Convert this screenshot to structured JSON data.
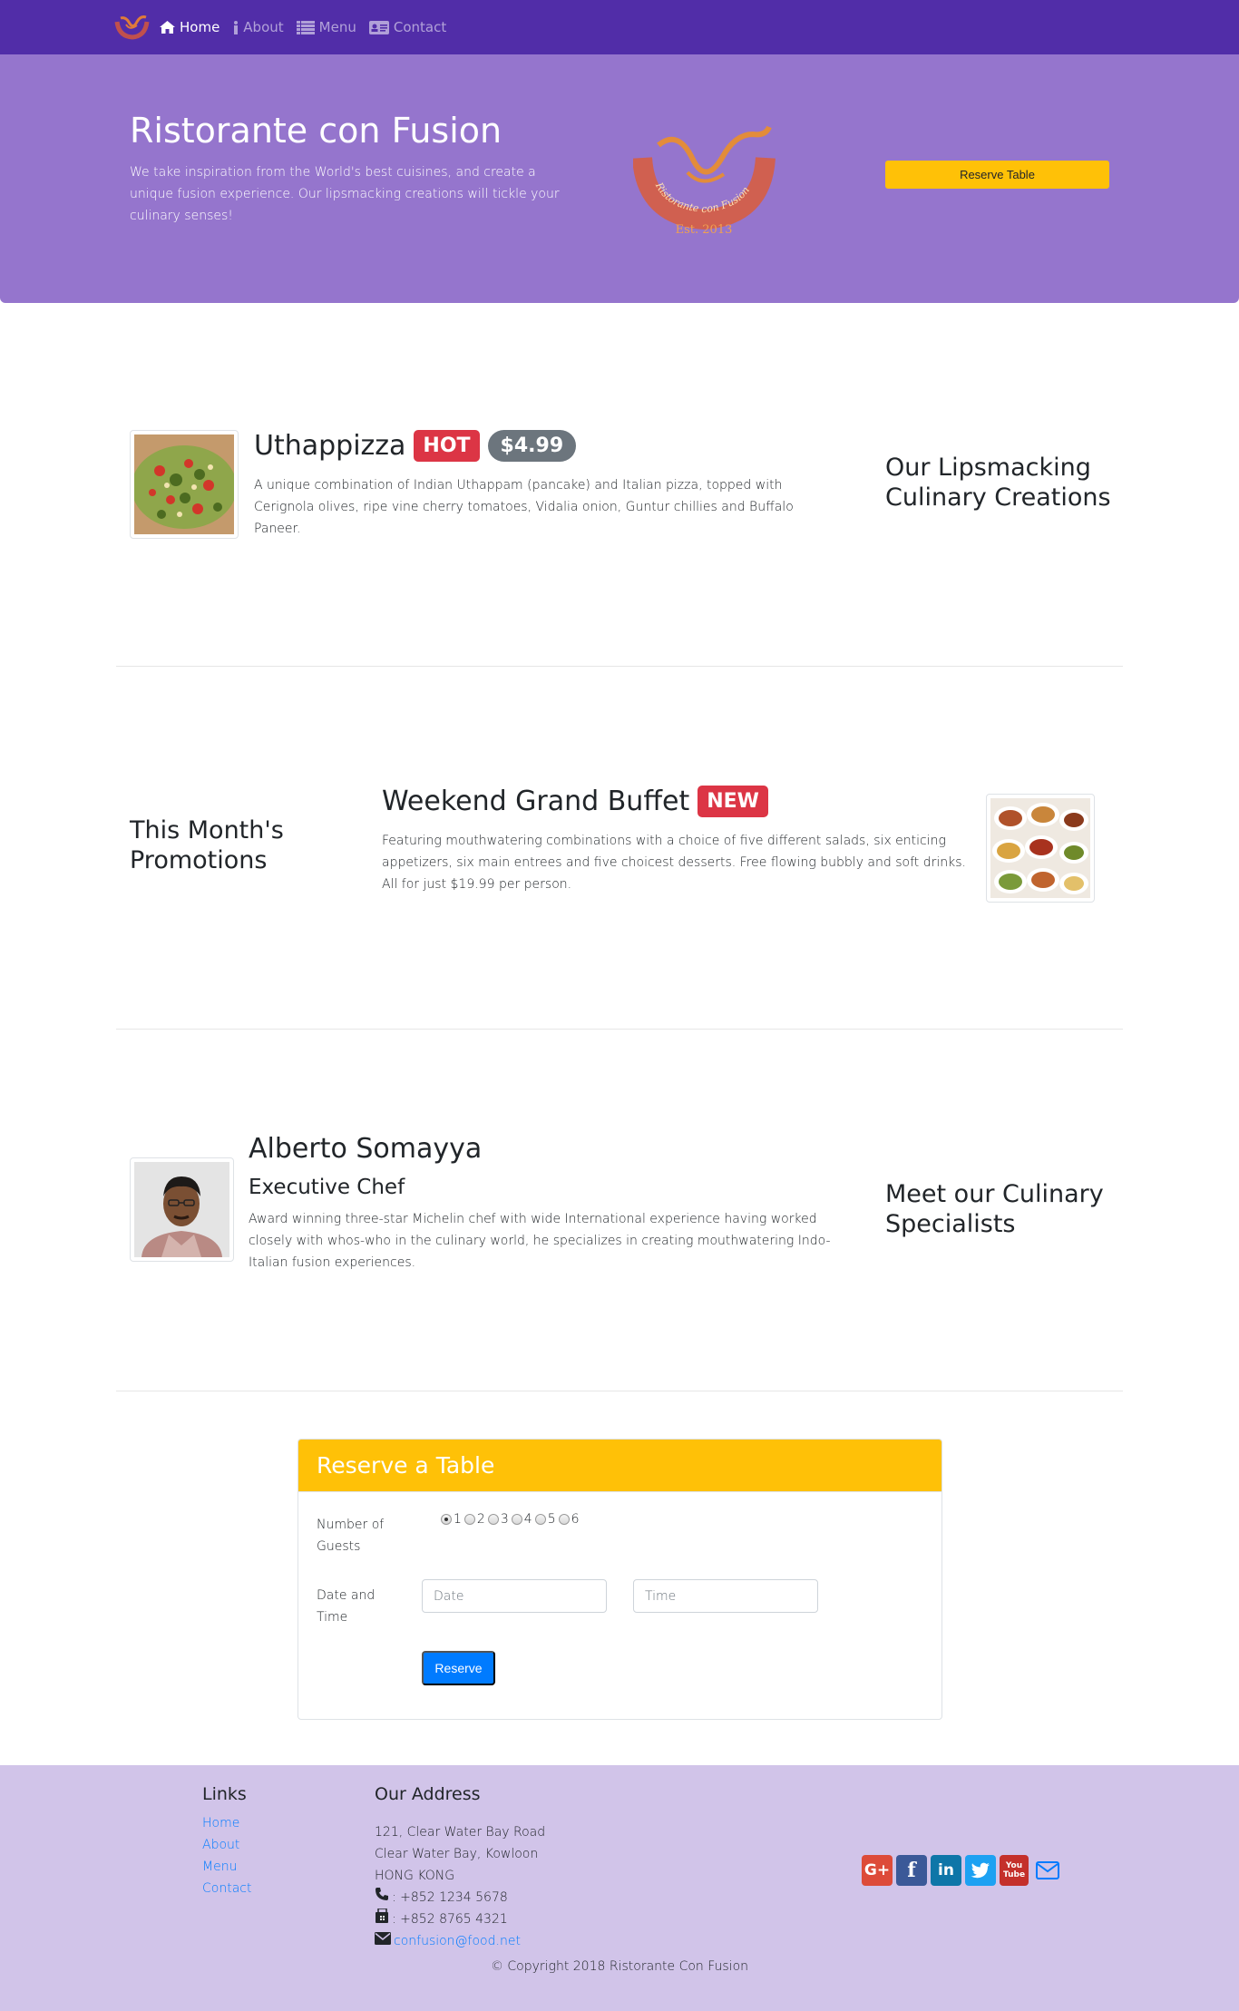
{
  "colors": {
    "navbar": "#512da8",
    "jumbotron": "#9575cd",
    "footer": "#d1c4e9",
    "warning": "#ffc107",
    "danger": "#dc3545",
    "secondary": "#6c757d",
    "primary": "#007bff"
  },
  "navbar": {
    "logo_icon": "restaurant-logo-icon",
    "items": [
      {
        "label": "Home",
        "icon": "home-icon",
        "active": true
      },
      {
        "label": "About",
        "icon": "info-icon",
        "active": false
      },
      {
        "label": "Menu",
        "icon": "list-icon",
        "active": false
      },
      {
        "label": "Contact",
        "icon": "address-card-icon",
        "active": false
      }
    ]
  },
  "jumbotron": {
    "title": "Ristorante con Fusion",
    "text": "We take inspiration from the World's best cuisines, and create a unique fusion experience. Our lipsmacking creations will tickle your culinary senses!",
    "logo_text": "Ristorante con Fusion",
    "logo_est": "Est. 2013",
    "reserve_button": "Reserve Table"
  },
  "dish": {
    "name": "Uthappizza",
    "badge": "HOT",
    "price": "$4.99",
    "description": "A unique combination of Indian Uthappam (pancake) and Italian pizza, topped with Cerignola olives, ripe vine cherry tomatoes, Vidalia onion, Guntur chillies and Buffalo Paneer.",
    "section_heading": "Our Lipsmacking Culinary Creations"
  },
  "promotion": {
    "section_heading": "This Month's Promotions",
    "name": "Weekend Grand Buffet",
    "badge": "NEW",
    "description": "Featuring mouthwatering combinations with a choice of five different salads, six enticing appetizers, six main entrees and five choicest desserts. Free flowing bubbly and soft drinks. All for just $19.99 per person."
  },
  "leader": {
    "name": "Alberto Somayya",
    "designation": "Executive Chef",
    "description": "Award winning three-star Michelin chef with wide International experience having worked closely with whos-who in the culinary world, he specializes in creating mouthwatering Indo-Italian fusion experiences.",
    "section_heading": "Meet our Culinary Specialists"
  },
  "reservation": {
    "title": "Reserve a Table",
    "guests_label": "Number of Guests",
    "guest_options": [
      "1",
      "2",
      "3",
      "4",
      "5",
      "6"
    ],
    "selected_guests": "1",
    "datetime_label": "Date and Time",
    "date_placeholder": "Date",
    "time_placeholder": "Time",
    "submit_label": "Reserve"
  },
  "footer": {
    "links_heading": "Links",
    "links": [
      "Home",
      "About",
      "Menu",
      "Contact"
    ],
    "address_heading": "Our Address",
    "address_lines": [
      "121, Clear Water Bay Road",
      "Clear Water Bay, Kowloon",
      "HONG KONG"
    ],
    "phone": ": +852 1234 5678",
    "fax": ": +852 8765 4321",
    "email": "confusion@food.net",
    "social": [
      {
        "icon": "google-plus-icon",
        "text": "G+"
      },
      {
        "icon": "facebook-icon",
        "text": "f"
      },
      {
        "icon": "linkedin-icon",
        "text": "in"
      },
      {
        "icon": "twitter-icon",
        "text": ""
      },
      {
        "icon": "youtube-icon",
        "text": "You Tube"
      },
      {
        "icon": "envelope-icon",
        "text": ""
      }
    ],
    "copyright": "© Copyright 2018 Ristorante Con Fusion"
  }
}
